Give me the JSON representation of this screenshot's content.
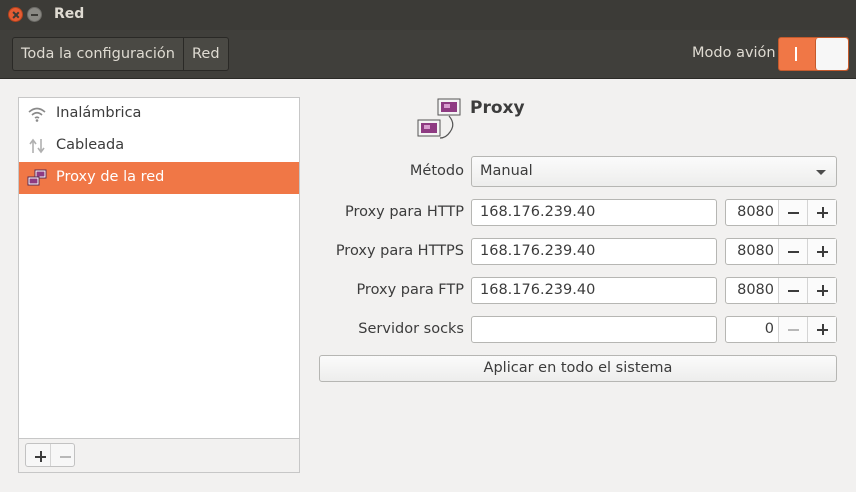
{
  "window": {
    "title": "Red"
  },
  "header": {
    "breadcrumbs": [
      "Toda la configuración",
      "Red"
    ],
    "airplane_mode_label": "Modo avión",
    "airplane_mode_on": true,
    "accent": "#f07746"
  },
  "sidebar": {
    "items": [
      {
        "label": "Inalámbrica",
        "icon": "wifi-icon",
        "selected": false
      },
      {
        "label": "Cableada",
        "icon": "wired-network-icon",
        "selected": false
      },
      {
        "label": "Proxy de la red",
        "icon": "network-proxy-icon",
        "selected": true
      }
    ],
    "add_icon": "plus-icon",
    "remove_icon": "minus-icon"
  },
  "proxy": {
    "title": "Proxy",
    "icon": "network-proxy-icon",
    "method": {
      "label": "Método",
      "value": "Manual"
    },
    "rows": [
      {
        "label": "Proxy para HTTP",
        "host": "168.176.239.40",
        "port": "8080"
      },
      {
        "label": "Proxy para HTTPS",
        "host": "168.176.239.40",
        "port": "8080"
      },
      {
        "label": "Proxy para FTP",
        "host": "168.176.239.40",
        "port": "8080"
      },
      {
        "label": "Servidor socks",
        "host": "",
        "port": "0"
      }
    ],
    "apply_label": "Aplicar en todo el sistema"
  }
}
